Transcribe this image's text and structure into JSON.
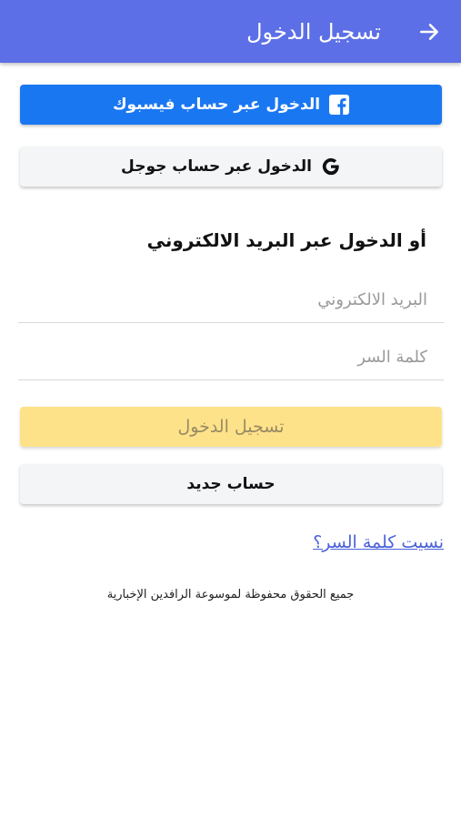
{
  "header": {
    "title": "تسجيل الدخول",
    "back_icon": "arrow-right-icon",
    "background_color": "#5c6fe6"
  },
  "social": {
    "facebook_label": "الدخول عبر حساب فيسبوك",
    "facebook_icon": "facebook-icon",
    "facebook_color": "#1a77f2",
    "google_label": "الدخول عبر حساب جوجل",
    "google_icon": "google-icon"
  },
  "email_section": {
    "heading": "أو الدخول عبر البريد الالكتروني",
    "email_placeholder": "البريد الالكتروني",
    "email_value": "",
    "password_placeholder": "كلمة السر",
    "password_value": ""
  },
  "actions": {
    "login_label": "تسجيل الدخول",
    "login_color": "#fde28a",
    "register_label": "حساب جديد",
    "forgot_password_label": "نسيت كلمة السر؟"
  },
  "footer": {
    "copyright": "جميع الحقوق محفوظة لموسوعة الرافدين الإخبارية"
  }
}
